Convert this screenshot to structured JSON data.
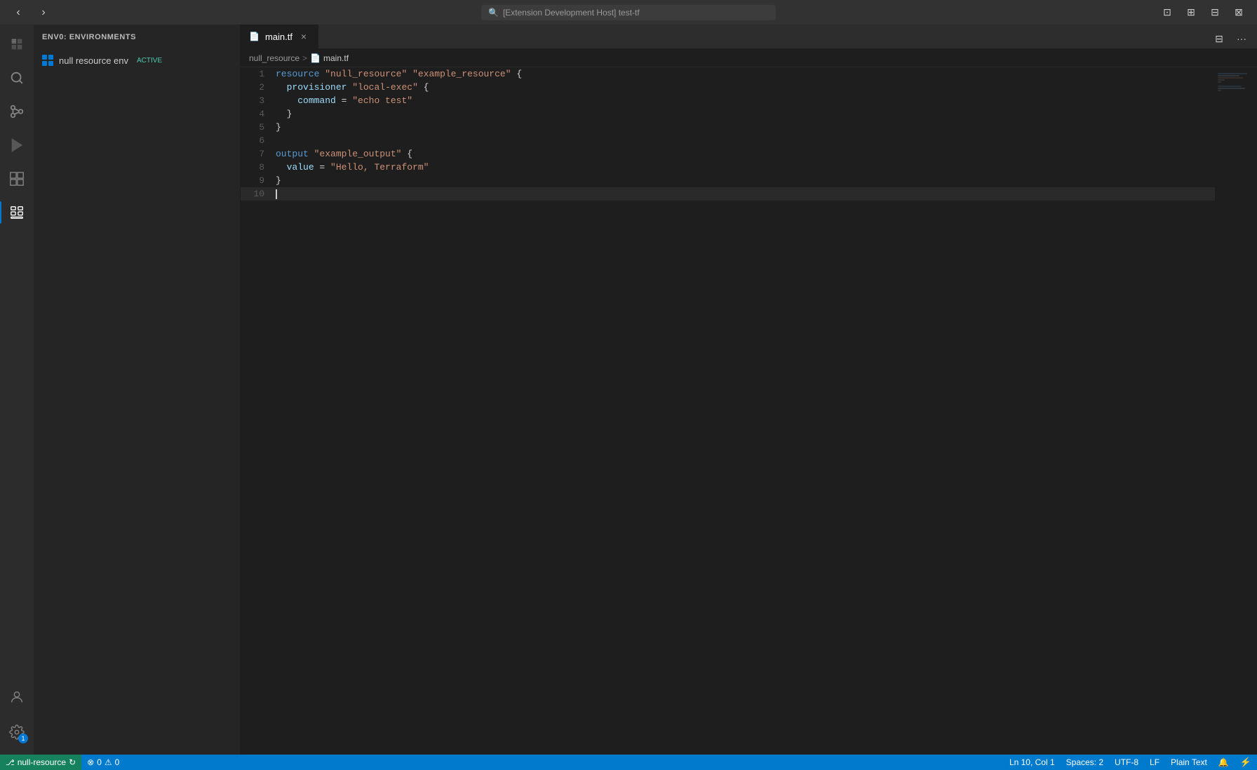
{
  "titleBar": {
    "backLabel": "←",
    "forwardLabel": "→",
    "searchPlaceholder": "[Extension Development Host] test-tf",
    "searchIcon": "🔍",
    "layoutIcons": [
      "⊡",
      "⊞",
      "⊟",
      "⊠"
    ]
  },
  "activityBar": {
    "items": [
      {
        "id": "explorer",
        "icon": "files",
        "active": false
      },
      {
        "id": "search",
        "icon": "search",
        "active": false
      },
      {
        "id": "source-control",
        "icon": "source-control",
        "active": false
      },
      {
        "id": "run",
        "icon": "run",
        "active": false
      },
      {
        "id": "extensions",
        "icon": "extensions",
        "active": false
      },
      {
        "id": "environments",
        "icon": "environments",
        "active": true
      }
    ],
    "bottomItems": [
      {
        "id": "account",
        "icon": "account"
      },
      {
        "id": "settings",
        "icon": "settings",
        "badge": "1"
      }
    ]
  },
  "sidebar": {
    "title": "ENV0: ENVIRONMENTS",
    "items": [
      {
        "label": "null resource env",
        "badge": "ACTIVE",
        "icon": "grid"
      }
    ]
  },
  "tabs": [
    {
      "filename": "main.tf",
      "active": true,
      "icon": "📄"
    }
  ],
  "breadcrumb": {
    "folder": "null_resource",
    "separator": ">",
    "file": "main.tf",
    "fileIcon": "📄"
  },
  "codeLines": [
    {
      "num": 1,
      "tokens": [
        {
          "t": "kw-resource",
          "v": "resource"
        },
        {
          "t": "",
          "v": " "
        },
        {
          "t": "kw-string",
          "v": "\"null_resource\""
        },
        {
          "t": "",
          "v": " "
        },
        {
          "t": "kw-string",
          "v": "\"example_resource\""
        },
        {
          "t": "",
          "v": " {"
        }
      ]
    },
    {
      "num": 2,
      "tokens": [
        {
          "t": "",
          "v": "  "
        },
        {
          "t": "kw-key",
          "v": "provisioner"
        },
        {
          "t": "",
          "v": " "
        },
        {
          "t": "kw-string",
          "v": "\"local-exec\""
        },
        {
          "t": "",
          "v": " {"
        }
      ]
    },
    {
      "num": 3,
      "tokens": [
        {
          "t": "",
          "v": "    "
        },
        {
          "t": "kw-key",
          "v": "command"
        },
        {
          "t": "",
          "v": " = "
        },
        {
          "t": "kw-string",
          "v": "\"echo test\""
        }
      ]
    },
    {
      "num": 4,
      "tokens": [
        {
          "t": "",
          "v": "  }"
        }
      ]
    },
    {
      "num": 5,
      "tokens": [
        {
          "t": "",
          "v": "}"
        }
      ]
    },
    {
      "num": 6,
      "tokens": [
        {
          "t": "",
          "v": ""
        }
      ]
    },
    {
      "num": 7,
      "tokens": [
        {
          "t": "kw-output",
          "v": "output"
        },
        {
          "t": "",
          "v": " "
        },
        {
          "t": "kw-string",
          "v": "\"example_output\""
        },
        {
          "t": "",
          "v": " {"
        }
      ]
    },
    {
      "num": 8,
      "tokens": [
        {
          "t": "",
          "v": "  "
        },
        {
          "t": "kw-value",
          "v": "value"
        },
        {
          "t": "",
          "v": " = "
        },
        {
          "t": "kw-string",
          "v": "\"Hello, Terraform\""
        }
      ]
    },
    {
      "num": 9,
      "tokens": [
        {
          "t": "",
          "v": "}"
        }
      ]
    },
    {
      "num": 10,
      "tokens": [
        {
          "t": "",
          "v": ""
        }
      ],
      "cursor": true
    }
  ],
  "statusBar": {
    "gitBranch": "null-resource",
    "syncIcon": "↻",
    "errorsCount": "0",
    "warningsCount": "0",
    "cursorPosition": "Ln 10, Col 1",
    "spaces": "Spaces: 2",
    "encoding": "UTF-8",
    "lineEnding": "LF",
    "language": "Plain Text",
    "notificationsIcon": "🔔",
    "remoteIcon": "⚡"
  }
}
